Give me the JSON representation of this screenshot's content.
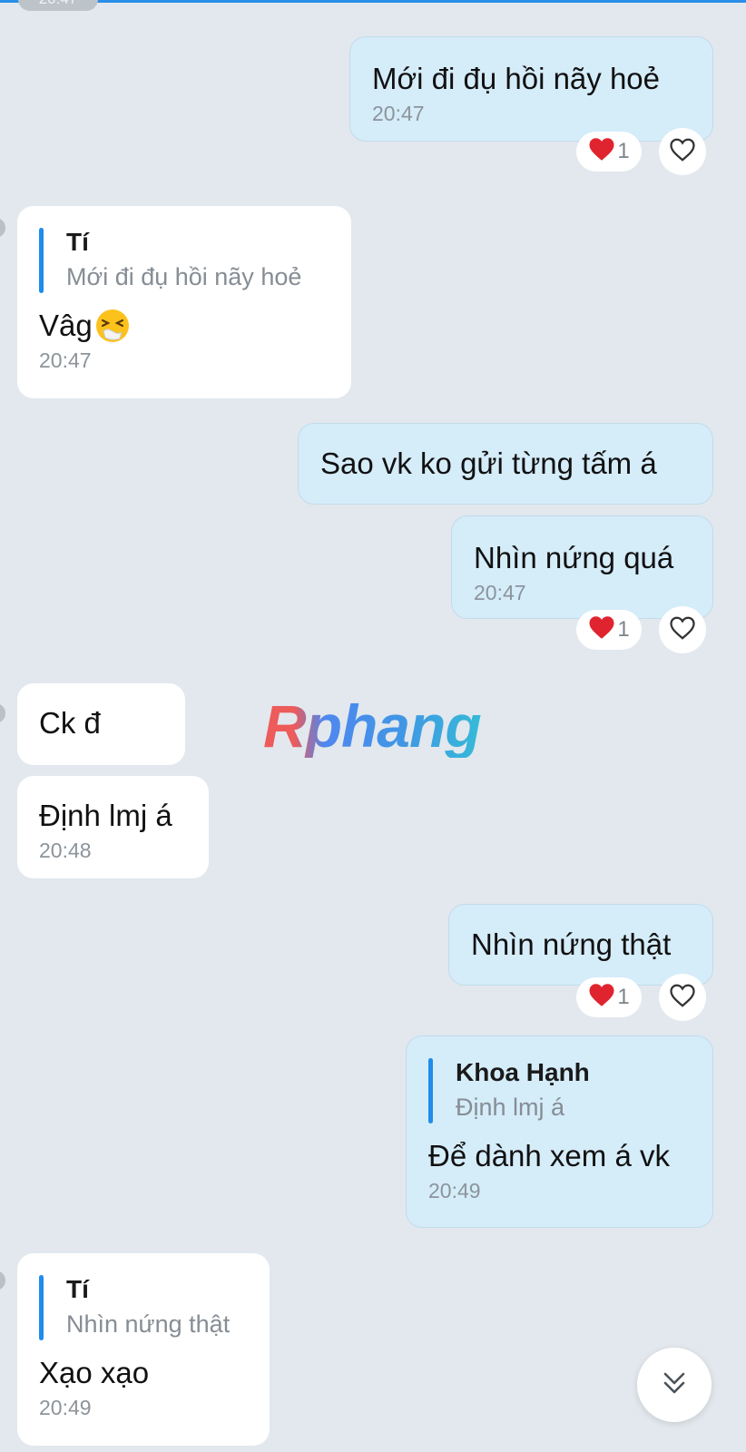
{
  "top_time": "20:47",
  "watermark": "Rphang",
  "messages": {
    "m1": {
      "text": "Mới đi đụ hồi nãy hoẻ",
      "time": "20:47",
      "reaction_count": "1"
    },
    "m2": {
      "quote_name": "Tí",
      "quote_text": "Mới đi đụ hồi nãy hoẻ",
      "text": "Vâg",
      "emoji": "sneezing-face",
      "time": "20:47"
    },
    "m3": {
      "text": "Sao vk ko gửi từng tấm á"
    },
    "m4": {
      "text": "Nhìn nứng quá",
      "time": "20:47",
      "reaction_count": "1"
    },
    "m5": {
      "text": "Ck đ"
    },
    "m6": {
      "text": "Định lmj á",
      "time": "20:48"
    },
    "m7": {
      "text": "Nhìn nứng thật",
      "reaction_count": "1"
    },
    "m8": {
      "quote_name": "Khoa Hạnh",
      "quote_text": "Định lmj á",
      "text": "Để dành xem á vk",
      "time": "20:49"
    },
    "m9": {
      "quote_name": "Tí",
      "quote_text": "Nhìn nứng thật",
      "text": "Xạo xạo",
      "time": "20:49"
    }
  },
  "colors": {
    "background": "#e2e8ed",
    "outgoing_bubble": "#d5ecf9",
    "incoming_bubble": "#ffffff",
    "quote_bar": "#1f8ceb",
    "heart": "#e0242f",
    "timestamp": "#8c949b"
  },
  "icons": {
    "reaction": "red-heart-icon",
    "like": "heart-outline-icon",
    "scroll": "double-chevron-down-icon"
  }
}
